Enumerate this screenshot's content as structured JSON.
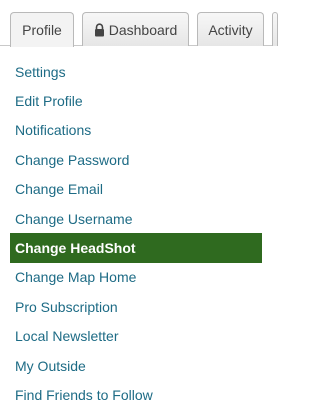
{
  "tabs": [
    {
      "label": "Profile",
      "icon": "",
      "active": true
    },
    {
      "label": "Dashboard",
      "icon": "lock-icon",
      "active": false
    },
    {
      "label": "Activity",
      "icon": "",
      "active": false
    }
  ],
  "menu": {
    "items": [
      {
        "label": "Settings"
      },
      {
        "label": "Edit Profile"
      },
      {
        "label": "Notifications"
      },
      {
        "label": "Change Password"
      },
      {
        "label": "Change Email"
      },
      {
        "label": "Change Username"
      },
      {
        "label": "Change HeadShot",
        "active": true
      },
      {
        "label": "Change Map Home"
      },
      {
        "label": "Pro Subscription"
      },
      {
        "label": "Local Newsletter"
      },
      {
        "label": "My Outside"
      },
      {
        "label": "Find Friends to Follow"
      }
    ]
  },
  "colors": {
    "link": "#1d6b85",
    "active_bg": "#2f6a1f",
    "active_text": "#ffffff"
  }
}
